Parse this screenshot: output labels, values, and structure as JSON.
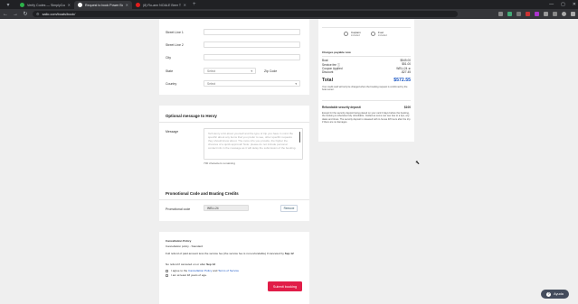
{
  "browser": {
    "tabs": [
      {
        "title": "Verify Codes — SimplyCodes",
        "fav_color": "#2db34a",
        "active": false
      },
      {
        "title": "Request to book Power Boat Tr...",
        "fav_color": "#ffffff",
        "active": true
      },
      {
        "title": "(8) Ro-ann NOALE Beer TE...",
        "fav_color": "#e11d1d",
        "active": false
      }
    ],
    "url": "sailo.com/boats/book/"
  },
  "address": {
    "street2_label": "Street Line 1",
    "street3_label": "Street Line 2",
    "city_label": "City",
    "state_label": "State",
    "state_value": "Select",
    "zip_label": "Zip Code",
    "country_label": "Country",
    "country_value": "Select"
  },
  "message": {
    "heading": "Optional message to Henry",
    "label": "Message",
    "placeholder": "Tell Henry a bit about yourself and the type of trip you have in mind. Be specific about any items that you prefer to see, other specific requests they should know about. The more info you provide, the higher the chances of a quick approval! Note: please do not include personal contact info in the message as it will delay the submission of the booking.",
    "remaining": "700 characters remaining"
  },
  "promo": {
    "heading": "Promotional Code and Boating Credits",
    "label": "Promotional code",
    "value": "WELL24",
    "remove_label": "Remove"
  },
  "cancellation": {
    "heading": "Cancellation Policy",
    "policy_line": "Cancellation policy - Standard",
    "text1": "Full refund of paid amount less the service fee (the service fee is non-refundable) if canceled by",
    "date1": "Sep 12",
    "text2": "No refund if canceled on or after",
    "date2": "Sep 12",
    "agree_prefix": "I agree to the",
    "agree_link1": "Cancellation Policy",
    "agree_and": "and",
    "agree_link2": "Terms of Service",
    "age_text": "I am at least 18 years of age.",
    "submit_label": "Submit booking"
  },
  "summary": {
    "captain_label": "Captain",
    "captain_sub": "included",
    "fuel_label": "Fuel",
    "fuel_sub": "included",
    "charges_heading": "Charges payable now",
    "rows": [
      {
        "label": "Boat",
        "value": "$549.00"
      },
      {
        "label": "Service fee",
        "value": "$51.00"
      },
      {
        "label": "Coupon Applied",
        "value": "WELL24"
      },
      {
        "label": "Discount",
        "value": "-$27.45"
      }
    ],
    "total_label": "Total",
    "total_value": "$572.55",
    "note": "Your credit card will only be charged when the booking request is confirmed by the boat owner.",
    "deposit_label": "Refundable security deposit",
    "deposit_value": "$100",
    "deposit_note": "Except for the security deposit being placed on your card 3 days before the booking, the booking is otherwise fully refundable. Jostled as some can see due to a tips, any dates and times. The security deposit is released with in-house 48 hours after the trip if there are no damages."
  },
  "help": {
    "label": "Ayuda"
  }
}
